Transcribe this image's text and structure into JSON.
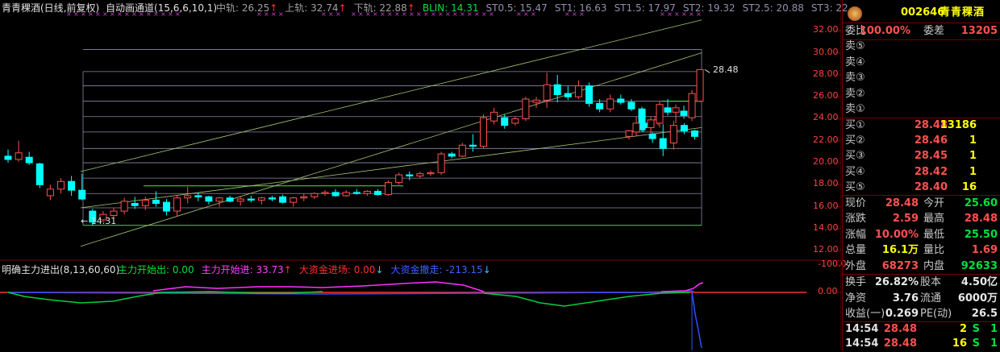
{
  "main_header": {
    "title": "青青稞酒(日线,前复权)",
    "indicator_name": "自动画通道(15,6,6,10,1)",
    "items": [
      {
        "label": "中轨",
        "value": "26.25",
        "arrow": "↑",
        "color": "#a0a0a0"
      },
      {
        "label": "上轨",
        "value": "32.74",
        "arrow": "↑",
        "color": "#a0a0a0"
      },
      {
        "label": "下轨",
        "value": "22.88",
        "arrow": "↑",
        "color": "#a0a0a0"
      },
      {
        "label": "BLIN",
        "value": "14.31",
        "arrow": "",
        "color": "#00e040"
      },
      {
        "label": "ST0.5",
        "value": "15.47",
        "arrow": "",
        "color": "#9090b0"
      },
      {
        "label": "ST1",
        "value": "16.63",
        "arrow": "",
        "color": "#9090b0"
      },
      {
        "label": "ST1.5",
        "value": "17.97",
        "arrow": "",
        "color": "#9090b0"
      },
      {
        "label": "ST2",
        "value": "19.32",
        "arrow": "",
        "color": "#9090b0"
      },
      {
        "label": "ST2.5",
        "value": "20.88",
        "arrow": "",
        "color": "#9090b0"
      },
      {
        "label": "ST3",
        "value": "22.",
        "arrow": "",
        "color": "#9090b0"
      }
    ]
  },
  "price_axis": [
    "32.00",
    "30.00",
    "28.00",
    "26.00",
    "24.00",
    "22.00",
    "20.00",
    "18.00",
    "16.00",
    "14.00",
    "12.00"
  ],
  "annotations": {
    "high": "28.48",
    "low": "14.31"
  },
  "sub_header": {
    "title": "明确主力进出(8,13,60,60)",
    "items": [
      {
        "label": "主力开始出",
        "value": "0.00",
        "arrow": "",
        "color": "#00e040"
      },
      {
        "label": "主力开始进",
        "value": "33.73",
        "arrow": "↑",
        "color": "#ff40ff"
      },
      {
        "label": "大资金进场",
        "value": "0.00",
        "arrow": "↓",
        "color": "#ff3030"
      },
      {
        "label": "大资金撤走",
        "value": "-213.15",
        "arrow": "↓",
        "color": "#4060ff"
      }
    ]
  },
  "sub_axis": [
    "0.00",
    "-100.0"
  ],
  "chart_data": {
    "type": "candlestick",
    "title": "青青稞酒(日线,前复权)",
    "price_range": [
      11.5,
      33.2
    ],
    "x_range": [
      0,
      70
    ],
    "candles": [
      {
        "x": 0,
        "o": 20.6,
        "h": 21.2,
        "l": 20.0,
        "c": 20.3
      },
      {
        "x": 1,
        "o": 20.3,
        "h": 22.0,
        "l": 20.1,
        "c": 20.9
      },
      {
        "x": 2,
        "o": 20.5,
        "h": 21.0,
        "l": 19.8,
        "c": 20.0
      },
      {
        "x": 3,
        "o": 19.9,
        "h": 20.0,
        "l": 17.7,
        "c": 18.0
      },
      {
        "x": 4,
        "o": 17.0,
        "h": 18.0,
        "l": 16.6,
        "c": 17.6
      },
      {
        "x": 5,
        "o": 17.6,
        "h": 18.6,
        "l": 17.2,
        "c": 18.3
      },
      {
        "x": 6,
        "o": 18.3,
        "h": 18.8,
        "l": 17.0,
        "c": 17.5
      },
      {
        "x": 7,
        "o": 17.5,
        "h": 19.0,
        "l": 16.6,
        "c": 16.7
      },
      {
        "x": 8,
        "o": 15.6,
        "h": 15.8,
        "l": 14.3,
        "c": 14.6
      },
      {
        "x": 9,
        "o": 14.8,
        "h": 15.6,
        "l": 14.6,
        "c": 15.3
      },
      {
        "x": 10,
        "o": 15.2,
        "h": 15.9,
        "l": 14.9,
        "c": 15.6
      },
      {
        "x": 11,
        "o": 15.6,
        "h": 16.8,
        "l": 15.3,
        "c": 16.5
      },
      {
        "x": 12,
        "o": 16.3,
        "h": 16.9,
        "l": 15.8,
        "c": 16.1
      },
      {
        "x": 13,
        "o": 16.1,
        "h": 16.9,
        "l": 15.7,
        "c": 16.6
      },
      {
        "x": 14,
        "o": 16.6,
        "h": 17.4,
        "l": 16.0,
        "c": 16.3
      },
      {
        "x": 15,
        "o": 16.4,
        "h": 16.7,
        "l": 15.2,
        "c": 15.6
      },
      {
        "x": 16,
        "o": 15.6,
        "h": 17.0,
        "l": 15.1,
        "c": 16.8
      },
      {
        "x": 17,
        "o": 16.8,
        "h": 17.8,
        "l": 16.3,
        "c": 17.0
      },
      {
        "x": 18,
        "o": 17.0,
        "h": 17.3,
        "l": 16.5,
        "c": 16.9
      },
      {
        "x": 19,
        "o": 16.9,
        "h": 17.0,
        "l": 16.2,
        "c": 16.5
      },
      {
        "x": 20,
        "o": 16.5,
        "h": 16.9,
        "l": 16.0,
        "c": 16.8
      },
      {
        "x": 21,
        "o": 16.8,
        "h": 17.0,
        "l": 16.4,
        "c": 16.5
      },
      {
        "x": 22,
        "o": 16.5,
        "h": 16.9,
        "l": 16.1,
        "c": 16.7
      },
      {
        "x": 23,
        "o": 16.7,
        "h": 17.0,
        "l": 16.4,
        "c": 16.6
      },
      {
        "x": 24,
        "o": 16.6,
        "h": 16.9,
        "l": 16.2,
        "c": 16.8
      },
      {
        "x": 25,
        "o": 16.8,
        "h": 17.0,
        "l": 16.5,
        "c": 16.7
      },
      {
        "x": 26,
        "o": 16.9,
        "h": 17.1,
        "l": 16.3,
        "c": 16.4
      },
      {
        "x": 27,
        "o": 16.4,
        "h": 16.9,
        "l": 16.0,
        "c": 16.8
      },
      {
        "x": 28,
        "o": 16.8,
        "h": 17.2,
        "l": 16.5,
        "c": 16.9
      },
      {
        "x": 29,
        "o": 16.9,
        "h": 17.3,
        "l": 16.7,
        "c": 17.2
      },
      {
        "x": 30,
        "o": 17.2,
        "h": 17.5,
        "l": 17.0,
        "c": 17.3
      },
      {
        "x": 31,
        "o": 17.3,
        "h": 17.6,
        "l": 16.9,
        "c": 17.0
      },
      {
        "x": 32,
        "o": 17.0,
        "h": 17.5,
        "l": 16.9,
        "c": 17.3
      },
      {
        "x": 33,
        "o": 17.3,
        "h": 17.6,
        "l": 17.1,
        "c": 17.2
      },
      {
        "x": 34,
        "o": 17.2,
        "h": 17.5,
        "l": 17.0,
        "c": 17.4
      },
      {
        "x": 35,
        "o": 17.4,
        "h": 17.6,
        "l": 17.0,
        "c": 17.1
      },
      {
        "x": 36,
        "o": 17.1,
        "h": 18.4,
        "l": 17.0,
        "c": 18.2
      },
      {
        "x": 37,
        "o": 18.2,
        "h": 19.1,
        "l": 18.0,
        "c": 18.9
      },
      {
        "x": 38,
        "o": 18.9,
        "h": 19.2,
        "l": 18.4,
        "c": 18.8
      },
      {
        "x": 39,
        "o": 18.8,
        "h": 19.2,
        "l": 18.6,
        "c": 19.0
      },
      {
        "x": 40,
        "o": 19.0,
        "h": 19.3,
        "l": 18.8,
        "c": 19.1
      },
      {
        "x": 41,
        "o": 19.1,
        "h": 21.0,
        "l": 18.9,
        "c": 20.8
      },
      {
        "x": 42,
        "o": 20.8,
        "h": 21.0,
        "l": 20.4,
        "c": 20.6
      },
      {
        "x": 43,
        "o": 20.6,
        "h": 21.8,
        "l": 20.5,
        "c": 21.6
      },
      {
        "x": 44,
        "o": 21.6,
        "h": 22.6,
        "l": 21.0,
        "c": 21.5
      },
      {
        "x": 45,
        "o": 21.5,
        "h": 24.4,
        "l": 21.3,
        "c": 24.1
      },
      {
        "x": 46,
        "o": 23.8,
        "h": 25.0,
        "l": 23.5,
        "c": 24.6
      },
      {
        "x": 47,
        "o": 24.1,
        "h": 24.4,
        "l": 23.1,
        "c": 23.4
      },
      {
        "x": 48,
        "o": 23.6,
        "h": 24.2,
        "l": 23.4,
        "c": 24.0
      },
      {
        "x": 49,
        "o": 24.0,
        "h": 26.0,
        "l": 23.8,
        "c": 25.8
      },
      {
        "x": 50,
        "o": 25.5,
        "h": 26.0,
        "l": 25.0,
        "c": 25.7
      },
      {
        "x": 51,
        "o": 25.7,
        "h": 28.2,
        "l": 25.0,
        "c": 27.1
      },
      {
        "x": 52,
        "o": 27.1,
        "h": 28.0,
        "l": 25.5,
        "c": 26.2
      },
      {
        "x": 53,
        "o": 26.3,
        "h": 27.0,
        "l": 25.7,
        "c": 26.0
      },
      {
        "x": 54,
        "o": 26.0,
        "h": 27.5,
        "l": 25.8,
        "c": 27.0
      },
      {
        "x": 55,
        "o": 27.0,
        "h": 27.3,
        "l": 25.1,
        "c": 25.4
      },
      {
        "x": 56,
        "o": 25.4,
        "h": 25.8,
        "l": 24.6,
        "c": 24.9
      },
      {
        "x": 57,
        "o": 24.9,
        "h": 26.2,
        "l": 24.6,
        "c": 25.8
      },
      {
        "x": 58,
        "o": 25.8,
        "h": 26.2,
        "l": 25.3,
        "c": 25.5
      },
      {
        "x": 59,
        "o": 25.5,
        "h": 25.8,
        "l": 24.7,
        "c": 24.9
      },
      {
        "x": 60,
        "o": 24.9,
        "h": 25.1,
        "l": 22.8,
        "c": 23.0
      },
      {
        "x": 61,
        "o": 22.6,
        "h": 22.8,
        "l": 21.8,
        "c": 22.2
      },
      {
        "x": 62,
        "o": 22.2,
        "h": 23.5,
        "l": 20.6,
        "c": 21.3
      },
      {
        "x": 63,
        "o": 21.8,
        "h": 23.8,
        "l": 21.2,
        "c": 23.4
      },
      {
        "x": 64,
        "o": 23.4,
        "h": 23.6,
        "l": 22.6,
        "c": 22.9
      },
      {
        "x": 65,
        "o": 22.9,
        "h": 23.0,
        "l": 22.1,
        "c": 22.4
      }
    ]
  },
  "side": {
    "code": "002646",
    "name": "青青稞酒",
    "weibi_label": "委比",
    "weibi_value": "100.00%",
    "weicha_label": "委差",
    "weicha_value": "13205",
    "sell": [
      {
        "label": "卖⑤",
        "price": "",
        "vol": ""
      },
      {
        "label": "卖④",
        "price": "",
        "vol": ""
      },
      {
        "label": "卖③",
        "price": "",
        "vol": ""
      },
      {
        "label": "卖②",
        "price": "",
        "vol": ""
      },
      {
        "label": "卖①",
        "price": "",
        "vol": ""
      }
    ],
    "buy": [
      {
        "label": "买①",
        "price": "28.48",
        "vol": "13186"
      },
      {
        "label": "买②",
        "price": "28.46",
        "vol": "1"
      },
      {
        "label": "买③",
        "price": "28.45",
        "vol": "1"
      },
      {
        "label": "买④",
        "price": "28.42",
        "vol": "1"
      },
      {
        "label": "买⑤",
        "price": "28.40",
        "vol": "16"
      }
    ],
    "quote": [
      {
        "l1": "现价",
        "v1": "28.48",
        "c1": "#ff5050",
        "l2": "今开",
        "v2": "25.60",
        "c2": "#00e040"
      },
      {
        "l1": "涨跌",
        "v1": "2.59",
        "c1": "#ff5050",
        "l2": "最高",
        "v2": "28.48",
        "c2": "#ff5050"
      },
      {
        "l1": "涨幅",
        "v1": "10.00%",
        "c1": "#ff5050",
        "l2": "最低",
        "v2": "25.50",
        "c2": "#00e040"
      },
      {
        "l1": "总量",
        "v1": "16.1万",
        "c1": "#ffff00",
        "l2": "量比",
        "v2": "1.69",
        "c2": "#ff5050"
      },
      {
        "l1": "外盘",
        "v1": "68273",
        "c1": "#ff5050",
        "l2": "内盘",
        "v2": "92633",
        "c2": "#00e040"
      }
    ],
    "stats": [
      {
        "l1": "换手",
        "v1": "26.82%",
        "l2": "股本",
        "v2": "4.50亿"
      },
      {
        "l1": "净资",
        "v1": "3.76",
        "l2": "流通",
        "v2": "6000万"
      },
      {
        "l1": "收益(一)",
        "v1": "0.269",
        "l2": "PE(动)",
        "v2": "26.5"
      }
    ],
    "ticks": [
      {
        "time": "14:54",
        "price": "28.48",
        "vol": "2",
        "flag": "S",
        "n": "1"
      },
      {
        "time": "14:54",
        "price": "28.48",
        "vol": "16",
        "flag": "S",
        "n": "1"
      }
    ]
  }
}
